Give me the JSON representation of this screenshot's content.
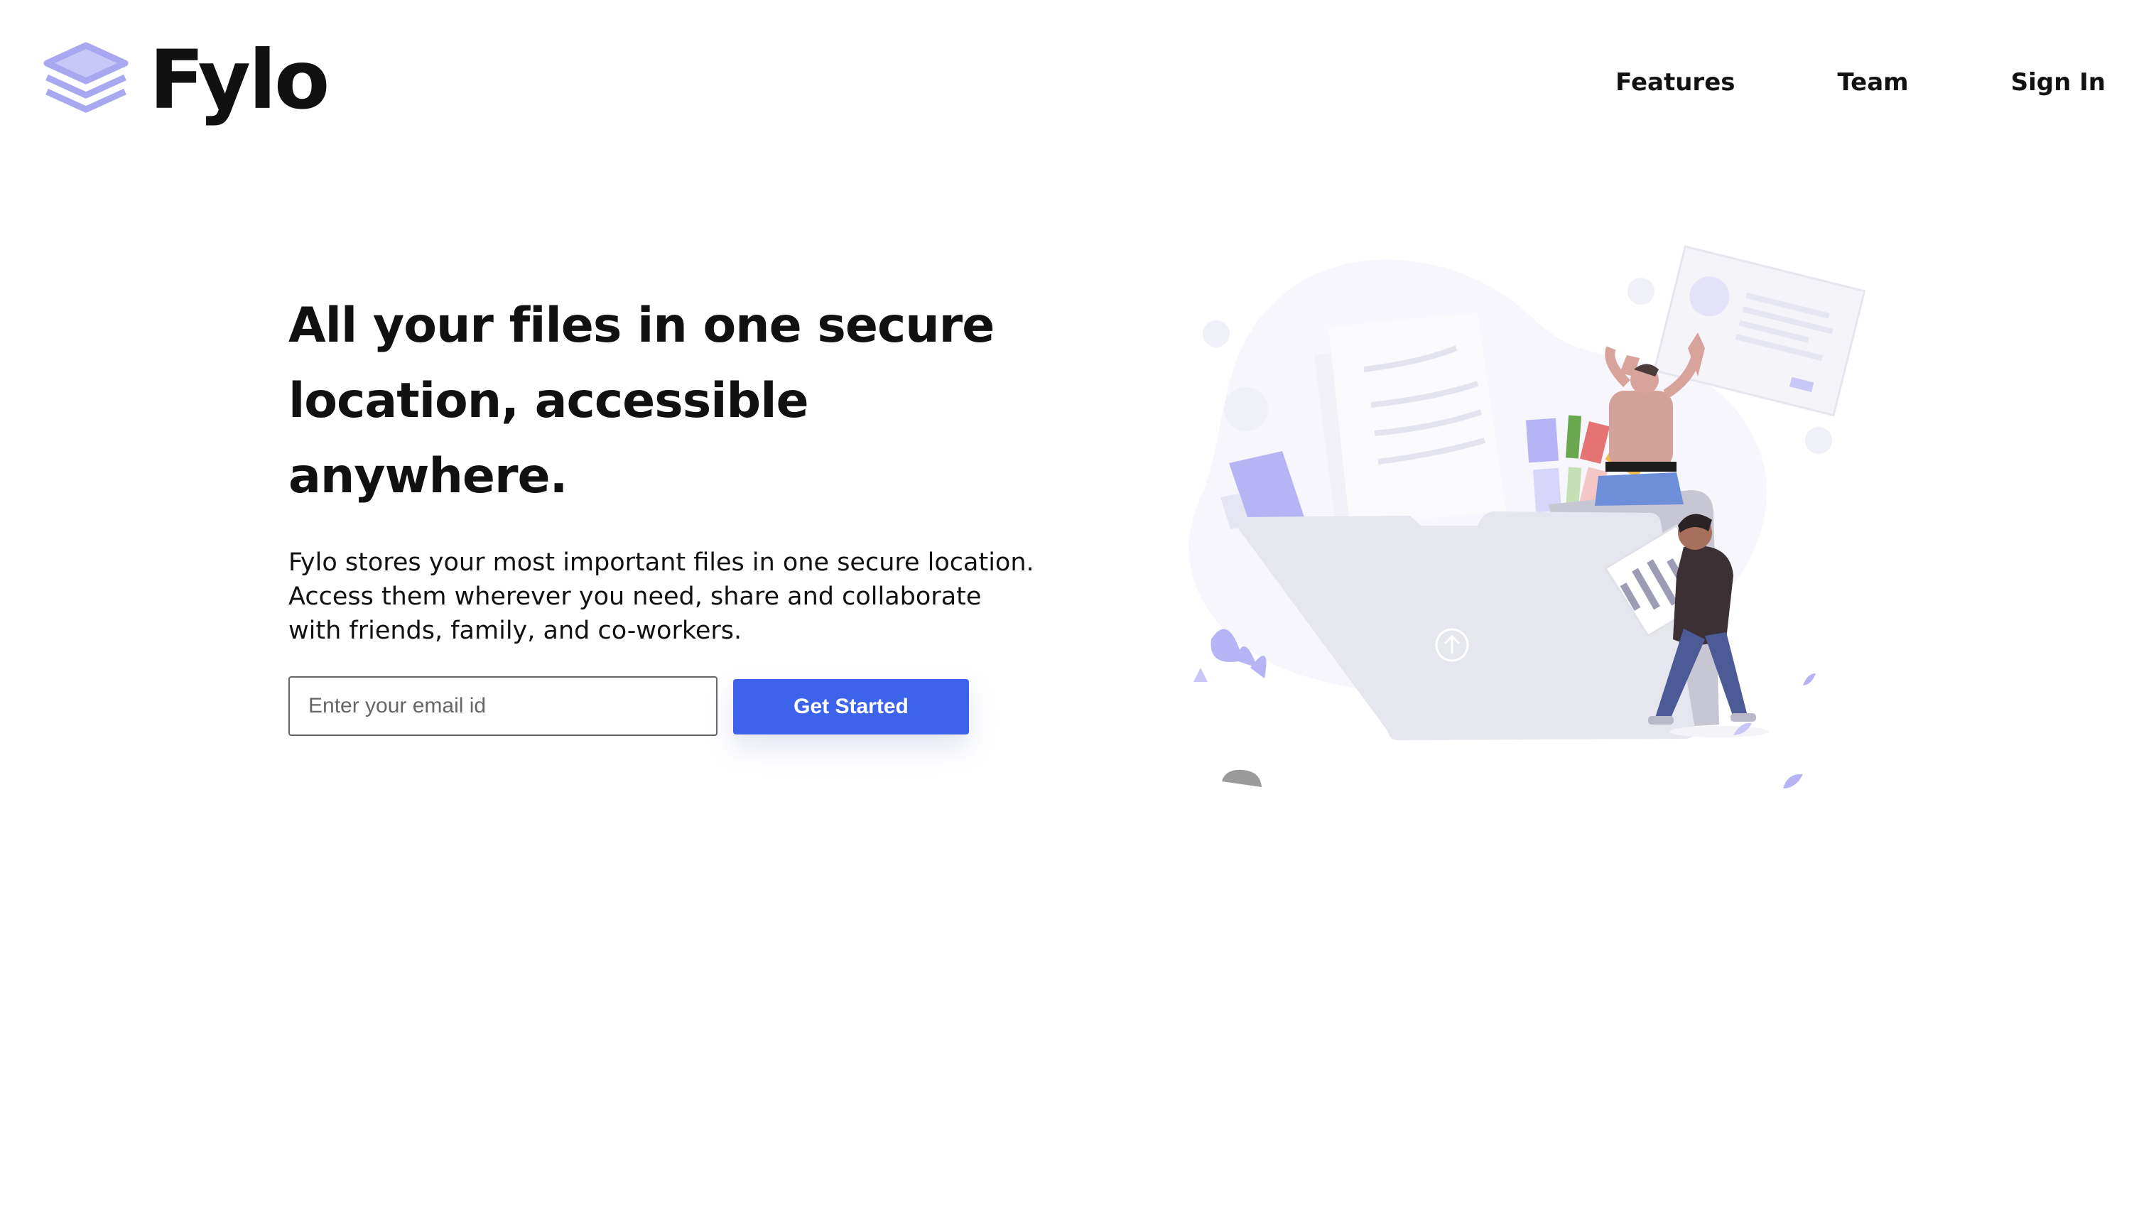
{
  "brand": {
    "name": "Fylo",
    "logo_icon": "layers-icon",
    "logo_color": "#a9a7f0"
  },
  "nav": {
    "items": [
      {
        "label": "Features"
      },
      {
        "label": "Team"
      },
      {
        "label": "Sign In"
      }
    ]
  },
  "hero": {
    "title": "All your files in one secure location, accessible anywhere.",
    "description": "Fylo stores your most important files in one secure location. Access them wherever you need, share and collaborate with friends, family, and co-workers.",
    "illustration": "file-upload-illustration"
  },
  "signup": {
    "email_placeholder": "Enter your email id",
    "email_value": "",
    "button_label": "Get Started"
  },
  "colors": {
    "accent": "#3d63ea",
    "text": "#111111",
    "illustration_purple": "#b7b4f5",
    "illustration_bg": "#f5f5fb"
  }
}
